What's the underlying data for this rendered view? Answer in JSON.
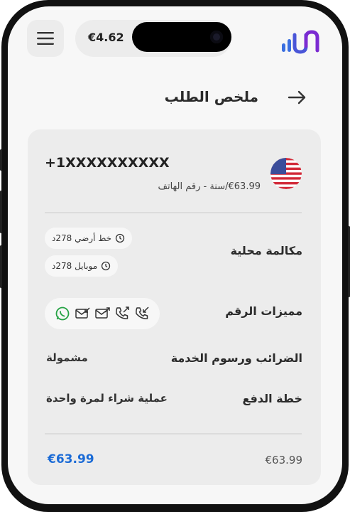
{
  "header": {
    "balance_text": "€4.62",
    "logo_alt": "logo"
  },
  "page": {
    "title": "ملخص الطلب"
  },
  "order": {
    "phone_number": "+1XXXXXXXXXX",
    "price_line": "€63.99/سنة - رقم الهاتف",
    "local_call_label": "مكالمة محلية",
    "landline_chip": "خط أرضي 278د",
    "mobile_chip": "موبايل 278د",
    "features_label": "مميزات الرقم",
    "taxes_label": "الضرائب ورسوم الخدمة",
    "taxes_value": "مشمولة",
    "plan_label": "خطة الدفع",
    "plan_value": "عملية شراء لمرة واحدة",
    "total_value": "€63.99",
    "total_label_partial": "€63.99"
  },
  "icons": [
    "incoming-call-icon",
    "outgoing-call-icon",
    "outgoing-sms-icon",
    "incoming-sms-icon",
    "whatsapp-icon"
  ],
  "colors": {
    "accent_blue": "#1b6bd6",
    "whatsapp_green": "#25a244",
    "logo_purple": "#6b2bd1",
    "logo_blue": "#3a6fe0"
  }
}
